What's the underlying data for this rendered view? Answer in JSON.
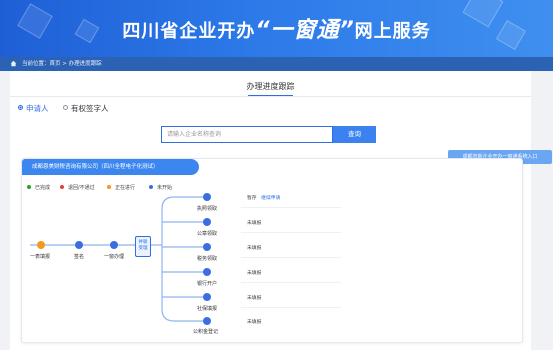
{
  "header": {
    "title_prefix": "四川省企业开办",
    "title_quote": "“一窗通”",
    "title_suffix": "网上服务"
  },
  "breadcrumb": {
    "text": "当前位置：首页 > 办理进度跟踪"
  },
  "page": {
    "title": "办理进度跟踪"
  },
  "applicant_type": {
    "options": [
      {
        "label": "申请人",
        "checked": true
      },
      {
        "label": "有权签字人",
        "checked": false
      }
    ]
  },
  "search": {
    "placeholder": "请输入企业名称查询",
    "button_label": "查询"
  },
  "side_link": {
    "label": "成都市新企业开办一窗通系统入口"
  },
  "tracker": {
    "company_name": "成都恩美财税咨询有限公司（四川全程电子化测试）",
    "legend": [
      {
        "label": "已完成",
        "color": "#2ca02c"
      },
      {
        "label": "退回/不通过",
        "color": "#e0413a"
      },
      {
        "label": "正在进行",
        "color": "#f39a1e"
      },
      {
        "label": "未开始",
        "color": "#3b6fe0"
      }
    ],
    "main_steps": [
      {
        "label": "一表填报",
        "status": "in-progress"
      },
      {
        "label": "签名",
        "status": "not-started"
      },
      {
        "label": "一窗办理",
        "status": "not-started"
      }
    ],
    "merge_node": {
      "label": "并联\n受理"
    },
    "branches": [
      {
        "label": "执照领取",
        "status_text": "暂存",
        "action_text": "继续申请"
      },
      {
        "label": "公章领取",
        "status_text": "未填报",
        "action_text": ""
      },
      {
        "label": "税务领取",
        "status_text": "未填报",
        "action_text": ""
      },
      {
        "label": "银行开户",
        "status_text": "未填报",
        "action_text": ""
      },
      {
        "label": "社保填报",
        "status_text": "未填报",
        "action_text": ""
      },
      {
        "label": "公积金登记",
        "status_text": "未填报",
        "action_text": ""
      }
    ]
  }
}
